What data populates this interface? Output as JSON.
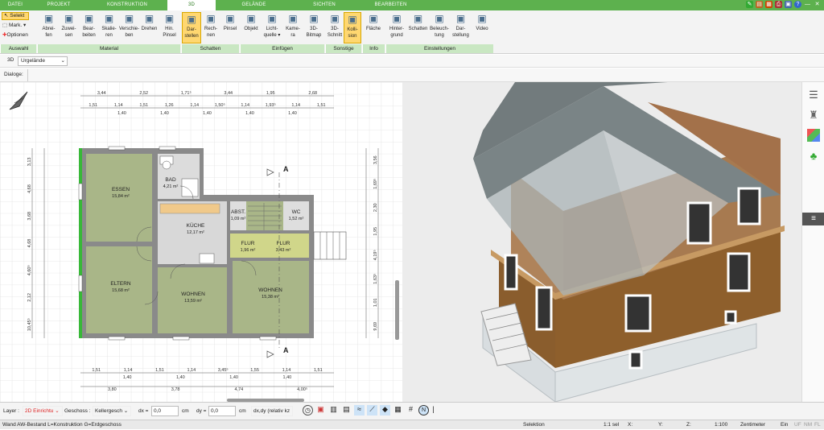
{
  "menubar": {
    "tabs": [
      "DATEI",
      "PROJEKT",
      "KONSTRUKTION",
      "3D",
      "GELÄNDE",
      "SICHTEN",
      "BEARBEITEN"
    ],
    "active": "3D",
    "accent": "#5db14e"
  },
  "ribbon": {
    "auswahl": {
      "select_label": "Selekt",
      "mark_label": "Mark.",
      "options_label": "Optionen",
      "group_label": "Auswahl"
    },
    "material": {
      "buttons": [
        {
          "label": "Abrei-\nfen"
        },
        {
          "label": "Zuwei-\nsen"
        },
        {
          "label": "Bear-\nbeiten"
        },
        {
          "label": "Skalie-\nren"
        },
        {
          "label": "Verschie-\nben"
        },
        {
          "label": "Drehen"
        },
        {
          "label": "Hin.\nPinsel"
        }
      ],
      "group_label": "Material"
    },
    "schatten": {
      "buttons": [
        {
          "label": "Dar-\nstellen"
        },
        {
          "label": "Rech-\nnen"
        },
        {
          "label": "Pinsel"
        }
      ],
      "group_label": "Schatten"
    },
    "einfuegen": {
      "buttons": [
        {
          "label": "Objekt"
        },
        {
          "label": "Licht-\nquelle ▾"
        },
        {
          "label": "Kame-\nra"
        },
        {
          "label": "3D-\nBitmap"
        }
      ],
      "group_label": "Einfügen"
    },
    "sonstige": {
      "buttons": [
        {
          "label": "3D-\nSchnitt"
        },
        {
          "label": "Kolli-\nsion"
        }
      ],
      "group_label": "Sonstige"
    },
    "info": {
      "buttons": [
        {
          "label": "Fläche"
        }
      ],
      "group_label": "Info"
    },
    "einstellungen": {
      "buttons": [
        {
          "label": "Hinter-\ngrund"
        },
        {
          "label": "Schatten"
        },
        {
          "label": "Beleuch-\ntung"
        },
        {
          "label": "Dar-\nstellung"
        },
        {
          "label": "Video"
        }
      ],
      "group_label": "Einstellungen"
    }
  },
  "toolbar2": {
    "mode": "3D",
    "terrain_select": "Urgelände"
  },
  "dialoge": {
    "label": "Dialoge:"
  },
  "plan": {
    "rooms": [
      {
        "name": "ESSEN",
        "area": "15,84 m²"
      },
      {
        "name": "BAD",
        "area": "4,21 m²"
      },
      {
        "name": "KÜCHE",
        "area": "12,17 m²"
      },
      {
        "name": "ABST.",
        "area": "1,09 m²"
      },
      {
        "name": "WC",
        "area": "1,52 m²"
      },
      {
        "name": "FLUR",
        "area": "1,96 m²"
      },
      {
        "name": "FLUR",
        "area": "3,43 m²"
      },
      {
        "name": "ELTERN",
        "area": "15,68 m²"
      },
      {
        "name": "WOHNEN",
        "area": "13,59 m²"
      },
      {
        "name": "WOHNEN",
        "area": "15,38 m²"
      }
    ],
    "section_marker": "A",
    "dims_top_row1": [
      "3,44",
      "2,52",
      "1,71⁵",
      "3,44",
      "1,95",
      "2,68"
    ],
    "dims_top_row2": [
      "1,51",
      "1,14",
      "1,51",
      "1,26",
      "1,14",
      "1,50⁵",
      "1,14",
      "1,93⁵",
      "1,14",
      "1,51"
    ],
    "dims_top_sub": [
      "1,40",
      "1,40",
      "1,40",
      "1,40",
      "1,40"
    ],
    "dims_bottom_row1": [
      "1,51",
      "1,14",
      "1,51",
      "1,14",
      "3,45⁵",
      "1,55",
      "1,14",
      "1,51"
    ],
    "dims_bottom_sub": [
      "1,40",
      "1,40",
      "1,40",
      "1,40"
    ],
    "dims_bottom_row2": [
      "3,80",
      "3,78",
      "4,74",
      "4,00⁵"
    ],
    "dims_left": [
      "3,13",
      "4,68",
      "3,68",
      "4,68",
      "4,60⁵",
      "2,12",
      "10,45⁵"
    ],
    "dims_right": [
      "3,56",
      "1,69⁵",
      "2,30",
      "1,95",
      "4,19⁵",
      "1,63⁵",
      "1,01",
      "9,69"
    ]
  },
  "statusbar": {
    "layer_label": "Layer :",
    "layer_value": "2D Einrichtu",
    "geschoss_label": "Geschoss :",
    "geschoss_value": "Kellergesch",
    "dx_label": "dx =",
    "dx_value": "0,0",
    "dy_label": "dy =",
    "dy_value": "0,0",
    "unit": "cm",
    "rel_label": "dx,dy (relativ kz"
  },
  "infobar": {
    "left": "Wand AW-Bestand L=Konstruktion G=Erdgeschoss",
    "mode": "Selektion",
    "sel": "1:1 sel",
    "x": "X:",
    "y": "Y:",
    "z": "Z:",
    "scale": "1:100",
    "unit": "Zentimeter",
    "ein": "Ein",
    "uf": "UF",
    "nm": "NM",
    "fl": "FL"
  }
}
